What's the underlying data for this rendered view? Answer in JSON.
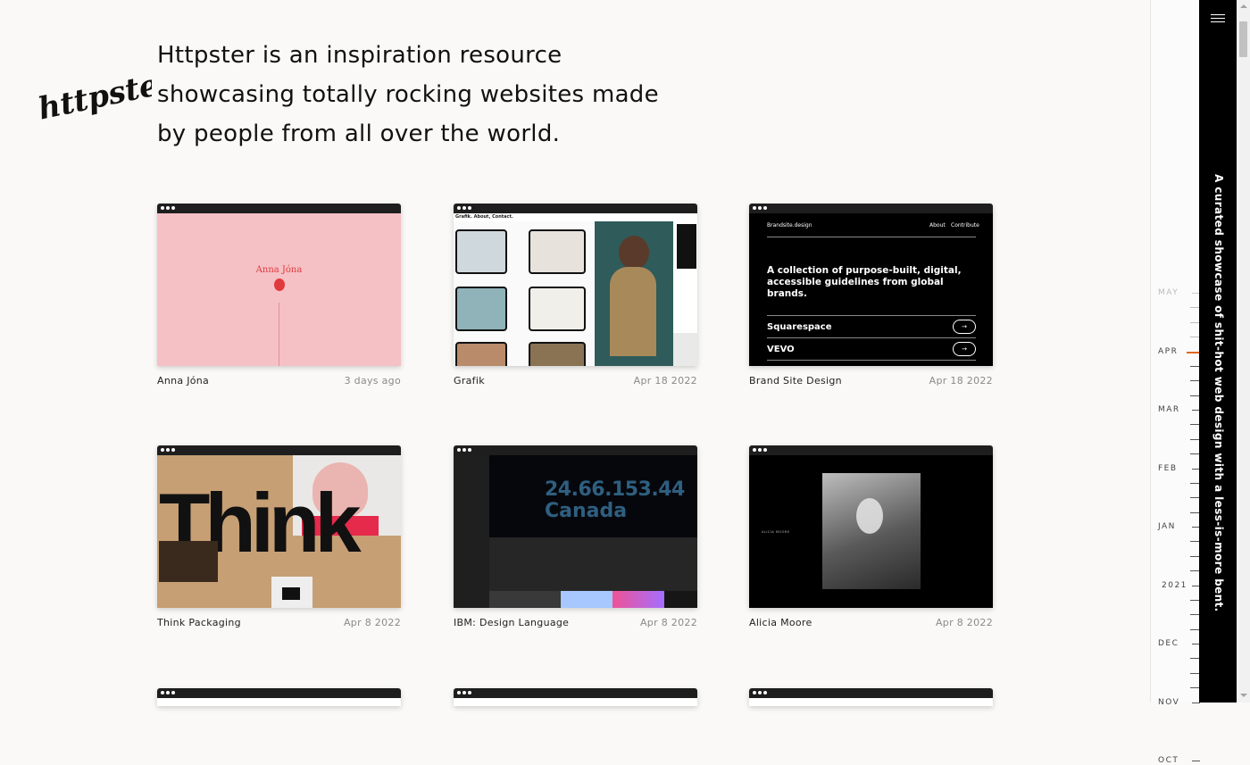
{
  "intro": "Httpster is an inspiration resource showcasing totally rocking websites made by people from all over the world.",
  "logo_text": "httpster",
  "tagline": "A curated showcase of shit-hot web design with a less-is-more bent.",
  "cards": [
    {
      "title": "Anna Jóna",
      "date": "3 days ago",
      "thumb_text": "Anna Jóna",
      "bg": "#f5c1c5"
    },
    {
      "title": "Grafik",
      "date": "Apr 18 2022",
      "thumb_text": "Grafik. About, Contact.",
      "bg": "#ffffff"
    },
    {
      "title": "Brand Site Design",
      "date": "Apr 18 2022",
      "thumb_brand": "Brandsite.design",
      "thumb_nav": [
        "About",
        "Contribute"
      ],
      "thumb_text": "A collection of purpose-built, digital, accessible guidelines from global brands.",
      "thumb_rows": [
        "Squarespace",
        "VEVO"
      ],
      "bg": "#000000"
    },
    {
      "title": "Think Packaging",
      "date": "Apr 8 2022",
      "thumb_text": "Think",
      "bg": "#c79f74"
    },
    {
      "title": "IBM: Design Language",
      "date": "Apr 8 2022",
      "thumb_ip": "24.66.153.44",
      "thumb_country": "Canada",
      "bg": "#161616"
    },
    {
      "title": "Alicia Moore",
      "date": "Apr 8 2022",
      "thumb_text": "ALICIA MOORE",
      "bg": "#000000"
    }
  ],
  "timeline": {
    "months": [
      "MAY",
      "APR",
      "MAR",
      "FEB",
      "JAN",
      "2021",
      "DEC",
      "NOV",
      "OCT"
    ],
    "active": "APR",
    "accent": "#e0661f"
  },
  "colors": {
    "background": "#faf9f7",
    "sidebar": "#000000"
  },
  "icons": {
    "menu": "hamburger-icon"
  }
}
